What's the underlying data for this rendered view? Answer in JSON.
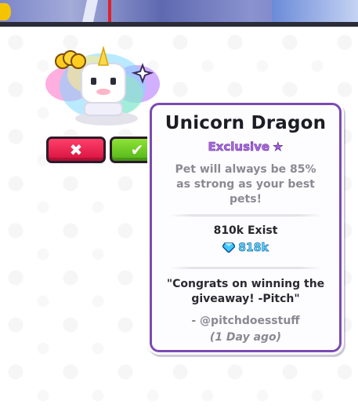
{
  "pet": {
    "name": "Unicorn Dragon",
    "rarity": "Exclusive",
    "description": "Pet will always be 85% as strong as your best pets!",
    "exist_count": "810k Exist",
    "value": "818k",
    "quote": "\"Congrats on winning the giveaway! -Pitch\"",
    "author": "- @pitchdoesstuff",
    "time_ago": "(1 Day ago)"
  },
  "buttons": {
    "decline_symbol": "✖",
    "accept_symbol": "✔"
  },
  "icons": {
    "rarity_star": "star-icon",
    "value_currency": "diamond-gem-icon"
  },
  "colors": {
    "tooltip_border": "#7b4bb3",
    "rarity_text": "#b16be6",
    "value_text": "#5fe4ff",
    "decline_button": "#e21b4a",
    "accept_button": "#6ccb25"
  }
}
